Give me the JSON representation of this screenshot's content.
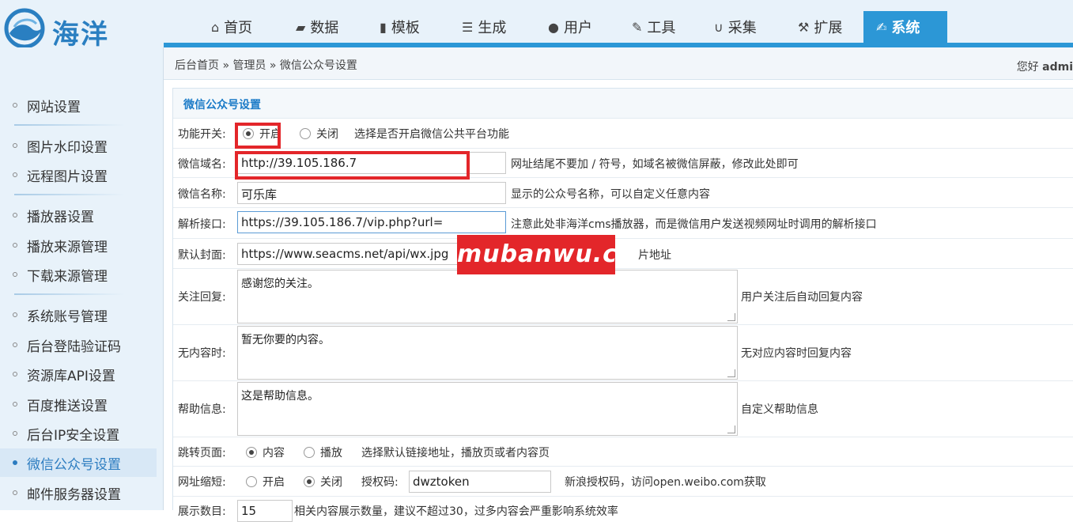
{
  "logo": {
    "text": "海洋"
  },
  "nav": [
    {
      "label": "首页",
      "icon": "home-icon",
      "glyph": "⌂"
    },
    {
      "label": "数据",
      "icon": "book-icon",
      "glyph": "▰"
    },
    {
      "label": "模板",
      "icon": "file-icon",
      "glyph": "▮"
    },
    {
      "label": "生成",
      "icon": "server-icon",
      "glyph": "☰"
    },
    {
      "label": "用户",
      "icon": "user-icon",
      "glyph": "●"
    },
    {
      "label": "工具",
      "icon": "wrench-icon",
      "glyph": "✎"
    },
    {
      "label": "采集",
      "icon": "magnet-icon",
      "glyph": "∪"
    },
    {
      "label": "扩展",
      "icon": "sitemap-icon",
      "glyph": "⚒"
    },
    {
      "label": "系统",
      "icon": "edit-icon",
      "glyph": "✍"
    }
  ],
  "breadcrumb": "后台首页 » 管理员 » 微信公众号设置",
  "greeting": {
    "prefix": "您好",
    "user": "admi"
  },
  "sidebar": [
    "网站设置",
    "图片水印设置",
    "远程图片设置",
    "播放器设置",
    "播放来源管理",
    "下载来源管理",
    "系统账号管理",
    "后台登陆验证码",
    "资源库API设置",
    "百度推送设置",
    "后台IP安全设置",
    "微信公众号设置",
    "邮件服务器设置"
  ],
  "panel_title": "微信公众号设置",
  "form": {
    "switch": {
      "label": "功能开关:",
      "on": "开启",
      "off": "关闭",
      "selected": "on",
      "hint": "选择是否开启微信公共平台功能"
    },
    "domain": {
      "label": "微信域名:",
      "value": "http://39.105.186.7",
      "hint": "网址结尾不要加 / 符号，如域名被微信屏蔽，修改此处即可"
    },
    "name": {
      "label": "微信名称:",
      "value": "可乐库",
      "hint": "显示的公众号名称，可以自定义任意内容"
    },
    "parser": {
      "label": "解析接口:",
      "value": "https://39.105.186.7/vip.php?url=",
      "hint": "注意此处非海洋cms播放器，而是微信用户发送视频网址时调用的解析接口"
    },
    "cover": {
      "label": "默认封面:",
      "value": "https://www.seacms.net/api/wx.jpg",
      "hint": "片地址"
    },
    "follow_reply": {
      "label": "关注回复:",
      "value": "感谢您的关注。",
      "hint": "用户关注后自动回复内容"
    },
    "no_content": {
      "label": "无内容时:",
      "value": "暂无你要的内容。",
      "hint": "无对应内容时回复内容"
    },
    "help": {
      "label": "帮助信息:",
      "value": "这是帮助信息。",
      "hint": "自定义帮助信息"
    },
    "jump": {
      "label": "跳转页面:",
      "opt1": "内容",
      "opt2": "播放",
      "selected": "opt1",
      "hint": "选择默认链接地址，播放页或者内容页"
    },
    "shorten": {
      "label": "网址缩短:",
      "opt1": "开启",
      "opt2": "关闭",
      "selected": "opt2",
      "auth_label": "授权码:",
      "auth_value": "dwztoken",
      "hint": "新浪授权码，访问open.weibo.com获取"
    },
    "display": {
      "label": "展示数目:",
      "value": "15",
      "hint": "相关内容展示数量，建议不超过30，过多内容会严重影响系统效率"
    }
  },
  "watermark": "mubanwu.cc",
  "colors": {
    "accent": "#2c97d6",
    "highlight": "#e3262a",
    "sidebar_bg": "#e8f2fa"
  }
}
